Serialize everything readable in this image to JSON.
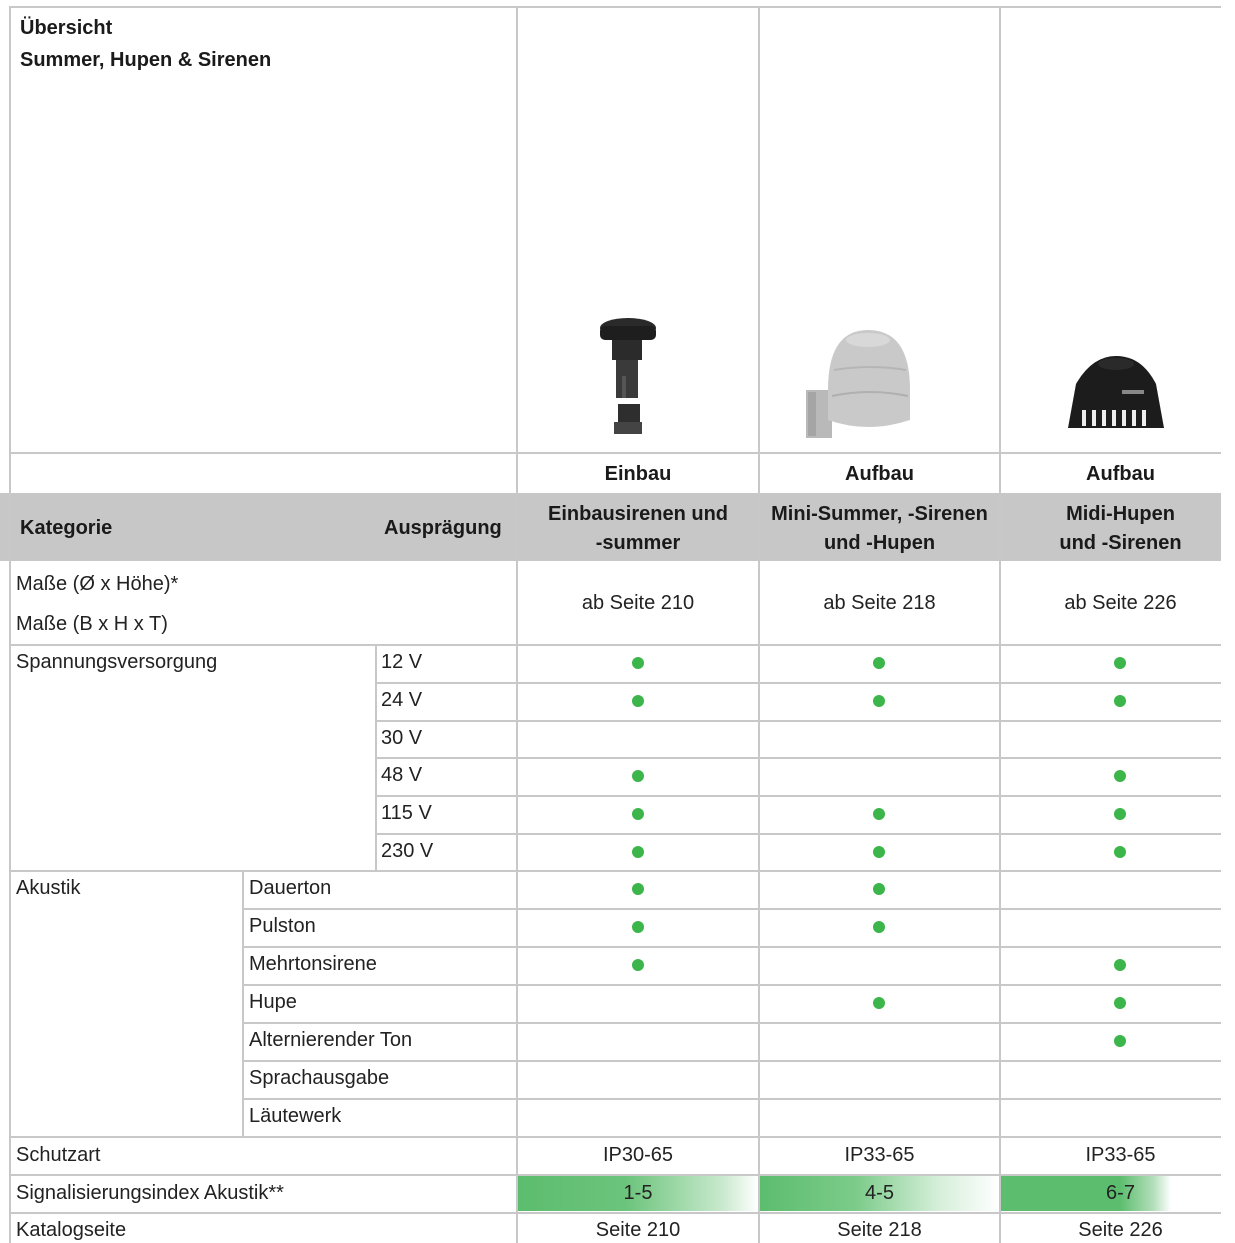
{
  "header": {
    "title": "Übersicht",
    "subtitle": "Summer, Hupen & Sirenen"
  },
  "columns": [
    {
      "mount": "Einbau",
      "name_line1": "Einbausirenen und",
      "name_line2": "-summer",
      "image_icon": "built-in-siren-image",
      "dims": "ab Seite 210",
      "ip": "IP30-65",
      "signal_index": "1-5",
      "page": "Seite 210"
    },
    {
      "mount": "Aufbau",
      "name_line1": "Mini-Summer, -Sirenen",
      "name_line2": "und -Hupen",
      "image_icon": "mini-summer-image",
      "dims": "ab Seite 218",
      "ip": "IP33-65",
      "signal_index": "4-5",
      "page": "Seite 218"
    },
    {
      "mount": "Aufbau",
      "name_line1": "Midi-Hupen",
      "name_line2": "und -Sirenen",
      "image_icon": "midi-hupe-image",
      "dims": "ab Seite 226",
      "ip": "IP33-65",
      "signal_index": "6-7",
      "page": "Seite 226"
    }
  ],
  "labels": {
    "kategorie": "Kategorie",
    "auspraegung": "Ausprägung",
    "mass1": "Maße (Ø x Höhe)*",
    "mass2": "Maße (B x H x T)",
    "spannung": "Spannungsversorgung",
    "akustik": "Akustik",
    "schutzart": "Schutzart",
    "signal": "Signalisierungsindex Akustik**",
    "katalog": "Katalogseite"
  },
  "voltages": [
    {
      "label": "12 V",
      "marks": [
        true,
        true,
        true
      ]
    },
    {
      "label": "24 V",
      "marks": [
        true,
        true,
        true
      ]
    },
    {
      "label": "30 V",
      "marks": [
        false,
        false,
        false
      ]
    },
    {
      "label": "48 V",
      "marks": [
        true,
        false,
        true
      ]
    },
    {
      "label": "115 V",
      "marks": [
        true,
        true,
        true
      ]
    },
    {
      "label": "230 V",
      "marks": [
        true,
        true,
        true
      ]
    }
  ],
  "acoustics": [
    {
      "label": "Dauerton",
      "marks": [
        true,
        true,
        false
      ]
    },
    {
      "label": "Pulston",
      "marks": [
        true,
        true,
        false
      ]
    },
    {
      "label": "Mehrtonsirene",
      "marks": [
        true,
        false,
        true
      ]
    },
    {
      "label": "Hupe",
      "marks": [
        false,
        true,
        true
      ]
    },
    {
      "label": "Alternierender Ton",
      "marks": [
        false,
        false,
        true
      ]
    },
    {
      "label": "Sprachausgabe",
      "marks": [
        false,
        false,
        false
      ]
    },
    {
      "label": "Läutewerk",
      "marks": [
        false,
        false,
        false
      ]
    }
  ],
  "colors": {
    "dot": "#3cb54a",
    "header_band": "#c7c7c7",
    "gradient": "#5cbd6e"
  }
}
